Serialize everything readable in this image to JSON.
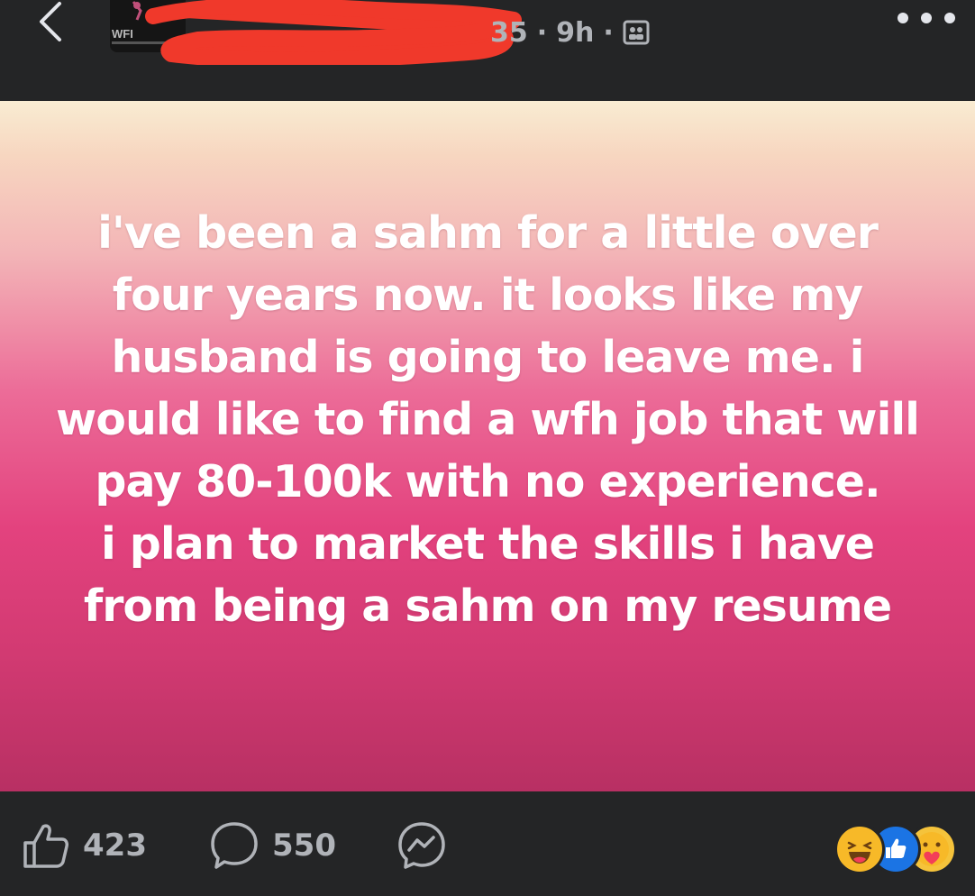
{
  "header": {
    "group_logo_text": "WFI",
    "meta": {
      "member_suffix": "35",
      "time": "9h",
      "separator": "·"
    }
  },
  "post": {
    "lines": [
      "i've been a sahm for a little over",
      "four years now. it looks like my",
      "husband is going to leave me. i",
      "would like to find a wfh job that will",
      "pay 80-100k with no experience.",
      "i plan to market the skills i have",
      "from being a sahm on my resume"
    ]
  },
  "footer": {
    "likes": "423",
    "comments": "550",
    "reactions": [
      "haha-icon",
      "like-icon",
      "care-icon"
    ]
  },
  "colors": {
    "bar_bg": "#242526",
    "muted_text": "#b0b3b8",
    "like_blue": "#1b74e4",
    "haha_yellow": "#f7b928"
  }
}
